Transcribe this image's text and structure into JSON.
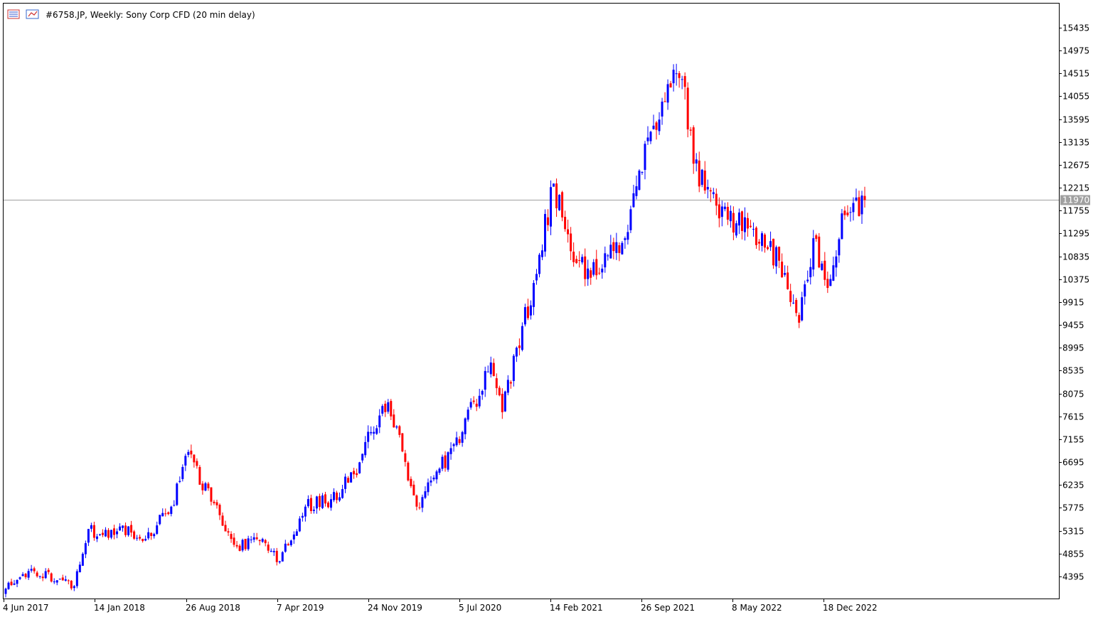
{
  "header": {
    "symbol_text": "#6758.JP, Weekly:  Sony Corp CFD (20 min delay)"
  },
  "icons": [
    "list-icon",
    "chart-icon"
  ],
  "colors": {
    "background": "#ffffff",
    "bull": "#0000ff",
    "bear": "#ff0000",
    "frame": "#000000",
    "price_line": "#a0a0a0",
    "price_tag_bg": "#a0a0a0",
    "price_tag_text": "#ffffff"
  },
  "chart_data": {
    "type": "candlestick",
    "x_ticks": [
      "4 Jun 2017",
      "14 Jan 2018",
      "26 Aug 2018",
      "7 Apr 2019",
      "24 Nov 2019",
      "5 Jul 2020",
      "14 Feb 2021",
      "26 Sep 2021",
      "8 May 2022",
      "18 Dec 2022"
    ],
    "y_ticks": [
      15435,
      14975,
      14515,
      14055,
      13595,
      13135,
      12675,
      12215,
      11755,
      11295,
      10835,
      10375,
      9915,
      9455,
      8995,
      8535,
      8075,
      7615,
      7155,
      6695,
      6235,
      5775,
      5315,
      4855,
      4395
    ],
    "y_tick_labels": [
      "15435",
      "14975",
      "14515",
      "14055",
      "13595",
      "13135",
      "12675",
      "12215",
      "11755",
      "11295",
      "10835",
      "10375",
      "9915",
      "9455",
      "8995",
      "8535",
      "8075",
      "7615",
      "7155",
      "6695",
      "6235",
      "5775",
      "5315",
      "4855",
      "4395"
    ],
    "ylim": [
      4000,
      15740
    ],
    "last_price": 11970,
    "last_price_label": "11970",
    "keypoints": [
      {
        "date": "4 Jun 2017",
        "close": 4150
      },
      {
        "date": "Aug 2017",
        "close": 4500
      },
      {
        "date": "Oct 2017",
        "close": 4350
      },
      {
        "date": "Nov 2017",
        "close": 4200
      },
      {
        "date": "Dec 2017",
        "close": 5350
      },
      {
        "date": "14 Jan 2018",
        "close": 5200
      },
      {
        "date": "Mar 2018",
        "close": 5400
      },
      {
        "date": "May 2018",
        "close": 5150
      },
      {
        "date": "Jul 2018",
        "close": 5800
      },
      {
        "date": "26 Aug 2018",
        "close": 6900
      },
      {
        "date": "Oct 2018",
        "close": 5900
      },
      {
        "date": "Dec 2018",
        "close": 5000
      },
      {
        "date": "Feb 2019",
        "close": 5150
      },
      {
        "date": "7 Apr 2019",
        "close": 4700
      },
      {
        "date": "Jun 2019",
        "close": 5800
      },
      {
        "date": "Aug 2019",
        "close": 5950
      },
      {
        "date": "Sep 2019",
        "close": 6450
      },
      {
        "date": "24 Nov 2019",
        "close": 7300
      },
      {
        "date": "Jan 2020",
        "close": 7900
      },
      {
        "date": "Feb 2020",
        "close": 6700
      },
      {
        "date": "Mar 2020",
        "close": 5800
      },
      {
        "date": "5 Jul 2020",
        "close": 7300
      },
      {
        "date": "Sep 2020",
        "close": 8700
      },
      {
        "date": "Oct 2020",
        "close": 7700
      },
      {
        "date": "Dec 2020",
        "close": 10300
      },
      {
        "date": "14 Feb 2021",
        "close": 12300
      },
      {
        "date": "Mar 2021",
        "close": 10700
      },
      {
        "date": "May 2021",
        "close": 10500
      },
      {
        "date": "Jul 2021",
        "close": 11200
      },
      {
        "date": "26 Sep 2021",
        "close": 13100
      },
      {
        "date": "Nov 2021",
        "close": 14300
      },
      {
        "date": "Dec 2021",
        "close": 14400
      },
      {
        "date": "Jan 2022",
        "close": 12700
      },
      {
        "date": "Mar 2022",
        "close": 11600
      },
      {
        "date": "8 May 2022",
        "close": 11500
      },
      {
        "date": "Jul 2022",
        "close": 11300
      },
      {
        "date": "Sep 2022",
        "close": 10500
      },
      {
        "date": "Oct 2022",
        "close": 9500
      },
      {
        "date": "Nov 2022",
        "close": 11200
      },
      {
        "date": "18 Dec 2022",
        "close": 10200
      },
      {
        "date": "Jan 2023",
        "close": 11700
      },
      {
        "date": "Feb 2023",
        "close": 11970
      }
    ]
  }
}
